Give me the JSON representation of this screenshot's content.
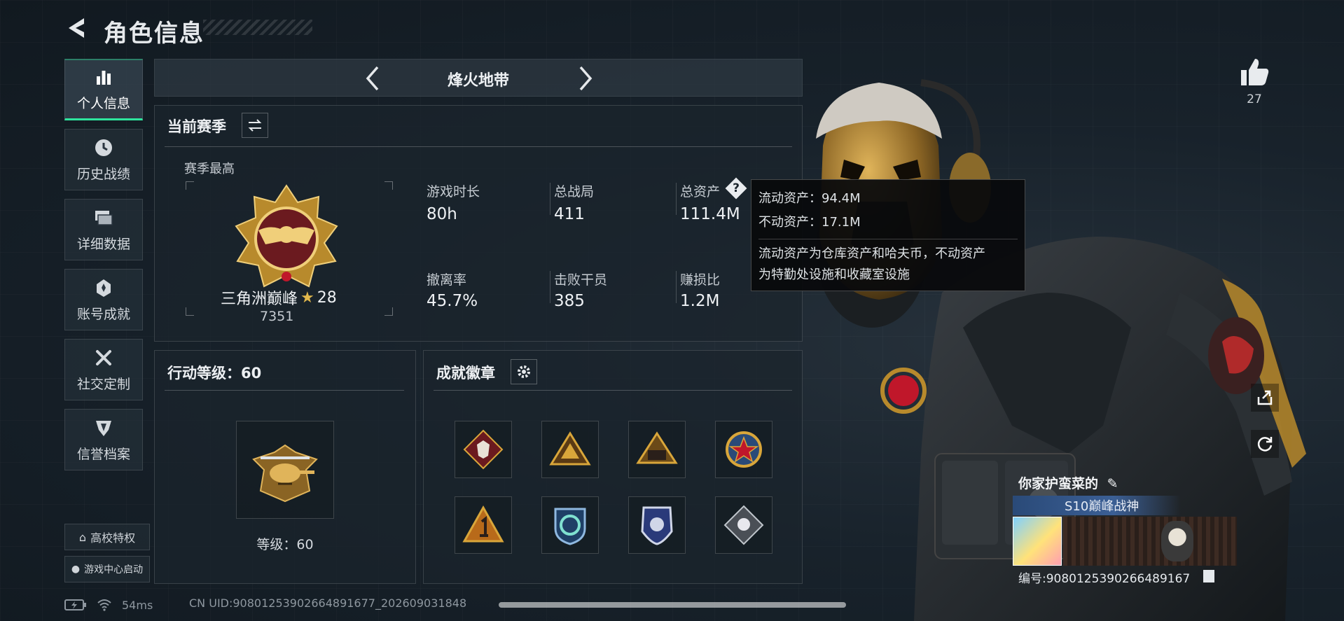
{
  "header": {
    "title": "角色信息"
  },
  "sidebar": {
    "items": [
      {
        "label": "个人信息",
        "icon": "bar-chart-icon",
        "active": true
      },
      {
        "label": "历史战绩",
        "icon": "clock-icon"
      },
      {
        "label": "详细数据",
        "icon": "stack-icon"
      },
      {
        "label": "账号成就",
        "icon": "achievement-icon"
      },
      {
        "label": "社交定制",
        "icon": "tools-icon"
      },
      {
        "label": "信誉档案",
        "icon": "shield-icon"
      }
    ],
    "campus_label": "高校特权",
    "game_center_label": "游戏中心启动"
  },
  "mode_selector": {
    "title": "烽火地带"
  },
  "season": {
    "title": "当前赛季",
    "best_label": "赛季最高",
    "rank_name": "三角洲巅峰",
    "rank_stars": "28",
    "rank_score": "7351",
    "stats": [
      {
        "label": "游戏时长",
        "value": "80h"
      },
      {
        "label": "总战局",
        "value": "411"
      },
      {
        "label": "总资产",
        "value": "111.4M"
      },
      {
        "label": "撤离率",
        "value": "45.7%"
      },
      {
        "label": "击败干员",
        "value": "385"
      },
      {
        "label": "赚损比",
        "value": "1.2M"
      }
    ]
  },
  "tooltip": {
    "liquid": "流动资产：94.4M",
    "fixed": "不动资产：17.1M",
    "desc_line1": "流动资产为仓库资产和哈夫币，不动资产",
    "desc_line2": "为特勤处设施和收藏室设施"
  },
  "action_level": {
    "title": "行动等级：60",
    "level_label": "等级：60"
  },
  "badges": {
    "title": "成就徽章",
    "items": [
      "badge-wolf",
      "badge-pyramid",
      "badge-squad",
      "badge-star",
      "badge-one",
      "badge-recycle",
      "badge-police",
      "badge-rose"
    ]
  },
  "profile": {
    "like_count": "27",
    "player_name": "你家护蛮菜的",
    "title": "S10巅峰战神",
    "uid_label": "编号:9080125390266489167"
  },
  "status_bar": {
    "ping": "54ms",
    "uid": "CN UID:9080125390266489167​7_202609031848"
  },
  "colors": {
    "accent": "#2ee59d",
    "gold": "#d9a63a",
    "panel": "#1a242c"
  }
}
